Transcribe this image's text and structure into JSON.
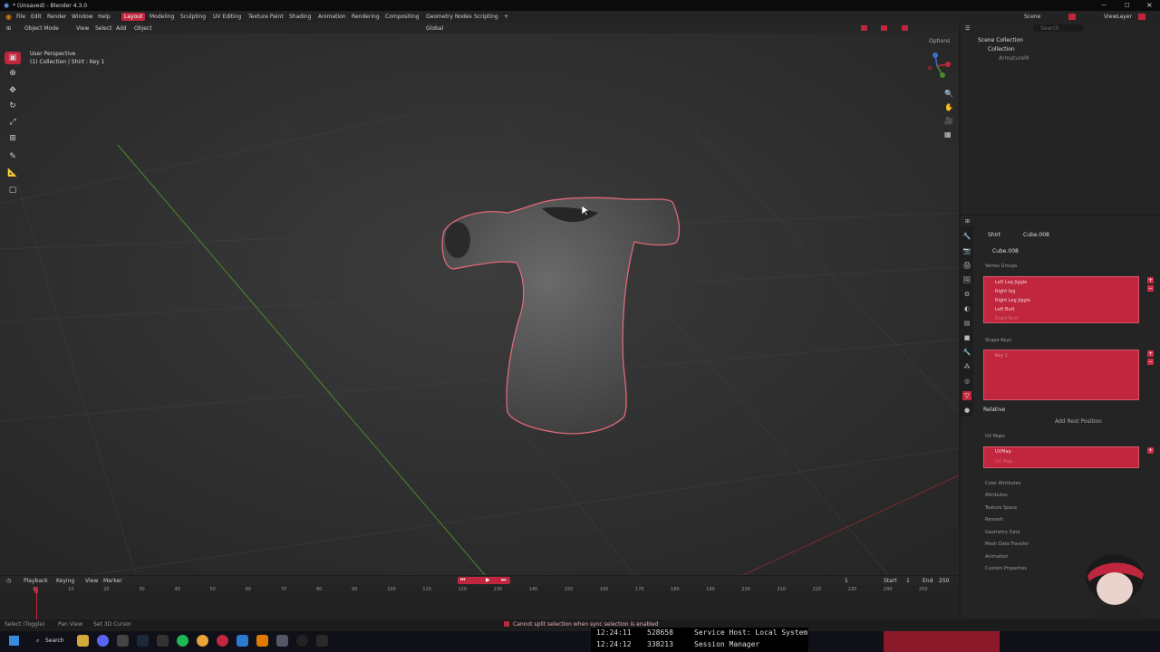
{
  "window": {
    "title": "* (Unsaved) - Blender 4.3.0"
  },
  "menu": [
    "File",
    "Edit",
    "Render",
    "Window",
    "Help"
  ],
  "workspaces": {
    "active": "Layout",
    "tabs": [
      "Modeling",
      "Sculpting",
      "UV Editing",
      "Texture Paint",
      "Shading",
      "Animation",
      "Rendering",
      "Compositing",
      "Geometry Nodes",
      "Scripting"
    ]
  },
  "scene": {
    "scene_label": "Scene",
    "viewlayer_label": "ViewLayer"
  },
  "viewport_header": {
    "mode": "Object Mode",
    "menus": [
      "View",
      "Select",
      "Add",
      "Object"
    ],
    "orientation": "Global",
    "options": "Options"
  },
  "viewport_info": {
    "line1": "User Perspective",
    "line2": "(1) Collection | Shirt : Key 1"
  },
  "outliner": {
    "search_placeholder": "Search",
    "scene_collection": "Scene Collection",
    "collection": "Collection",
    "item": "ArmatureM"
  },
  "properties": {
    "breadcrumb_object": "Shirt",
    "breadcrumb_mesh": "Cube.008",
    "mesh_name": "Cube.008",
    "vertex_groups_title": "Vertex Groups",
    "vertex_groups": [
      "Left Leg Jiggle",
      "Right leg",
      "Right Leg Jiggle",
      "Left Butt",
      "Right Butt"
    ],
    "shape_keys_title": "Shape Keys",
    "shape_keys": [
      "Key 1"
    ],
    "relative_label": "Relative",
    "add_rest_position": "Add Rest Position",
    "uv_maps_title": "UV Maps",
    "uv_maps": [
      "UVMap",
      "UV Map"
    ],
    "collapsed_panels": [
      "Color Attributes",
      "Attributes",
      "Texture Space",
      "Remesh",
      "Geometry Data",
      "Mesh Data Transfer",
      "Animation",
      "Custom Properties"
    ]
  },
  "timeline": {
    "menus": [
      "Playback",
      "Keying",
      "View",
      "Marker"
    ],
    "current_frame": "1",
    "start_label": "Start",
    "start": "1",
    "end_label": "End",
    "end": "250",
    "ticks": [
      "1",
      "10",
      "20",
      "30",
      "40",
      "50",
      "60",
      "70",
      "80",
      "90",
      "100",
      "110",
      "120",
      "130",
      "140",
      "150",
      "160",
      "170",
      "180",
      "190",
      "200",
      "210",
      "220",
      "230",
      "240",
      "250"
    ]
  },
  "statusbar": {
    "left": [
      "Select (Toggle)",
      "Pan View",
      "Set 3D Cursor"
    ],
    "warning": "Cannot split selection when sync selection is enabled"
  },
  "taskbar": {
    "search": "Search",
    "overlay_line1_time": "12:24:11",
    "overlay_line1_num": "528658",
    "overlay_line1_text": "Service Host: Local System",
    "overlay_line2_time": "12:24:12",
    "overlay_line2_num": "338213",
    "overlay_line2_text": "Session Manager"
  },
  "colors": {
    "accent": "#c0263d",
    "outline": "#e06878",
    "x_axis": "#7a2a30",
    "y_axis": "#4a8a2a"
  }
}
